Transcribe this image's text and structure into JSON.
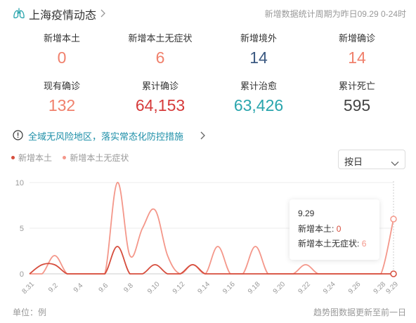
{
  "header": {
    "title": "上海疫情动态",
    "note": "新增数据统计周期为昨日09.29 0-24时",
    "icon": "lungs-icon"
  },
  "stats": [
    {
      "label": "新增本土",
      "value": "0",
      "color": "#f0806c"
    },
    {
      "label": "新增本土无症状",
      "value": "6",
      "color": "#f0806c"
    },
    {
      "label": "新增境外",
      "value": "14",
      "color": "#3c5a82"
    },
    {
      "label": "新增确诊",
      "value": "14",
      "color": "#f0806c"
    },
    {
      "label": "现有确诊",
      "value": "132",
      "color": "#f0806c"
    },
    {
      "label": "累计确诊",
      "value": "64,153",
      "color": "#d63a3a"
    },
    {
      "label": "累计治愈",
      "value": "63,426",
      "color": "#2aa5ad"
    },
    {
      "label": "累计死亡",
      "value": "595",
      "color": "#444444"
    }
  ],
  "notice": {
    "text": "全域无风险地区，落实常态化防控措施"
  },
  "legend": [
    {
      "label": "新增本土",
      "color": "#d64d3d"
    },
    {
      "label": "新增本土无症状",
      "color": "#f4978a"
    }
  ],
  "select": {
    "value": "按日"
  },
  "tooltip": {
    "date": "9.29",
    "row1_label": "新增本土:",
    "row1_value": "0",
    "row2_label": "新增本土无症状:",
    "row2_value": "6"
  },
  "footer": {
    "left": "单位：例",
    "right": "趋势图数据更新至前一日"
  },
  "chart_data": {
    "type": "line",
    "x": [
      "8.31",
      "9.1",
      "9.2",
      "9.3",
      "9.4",
      "9.5",
      "9.6",
      "9.7",
      "9.8",
      "9.9",
      "9.10",
      "9.11",
      "9.12",
      "9.13",
      "9.14",
      "9.15",
      "9.16",
      "9.17",
      "9.18",
      "9.19",
      "9.20",
      "9.21",
      "9.22",
      "9.23",
      "9.24",
      "9.25",
      "9.26",
      "9.27",
      "9.28",
      "9.29"
    ],
    "x_tick_labels": [
      "8.31",
      "9.2",
      "9.4",
      "9.6",
      "9.8",
      "9.10",
      "9.12",
      "9.14",
      "9.16",
      "9.18",
      "9.20",
      "9.22",
      "9.24",
      "9.26",
      "9.28",
      "9.29"
    ],
    "y_ticks": [
      0,
      5,
      10
    ],
    "ylim": [
      0,
      11
    ],
    "series": [
      {
        "name": "新增本土",
        "color": "#d64d3d",
        "values": [
          0,
          1,
          1,
          0,
          0,
          0,
          0,
          3,
          0,
          0,
          1,
          0,
          0,
          1,
          0,
          0,
          0,
          0,
          0,
          0,
          0,
          0,
          0,
          0,
          0,
          0,
          0,
          0,
          0,
          0
        ]
      },
      {
        "name": "新增本土无症状",
        "color": "#f4978a",
        "values": [
          0,
          0,
          2,
          0,
          0,
          0,
          0,
          10,
          2,
          5,
          7,
          2,
          0,
          1,
          0,
          3,
          0,
          0,
          3,
          0,
          0,
          0,
          1,
          0,
          0,
          0,
          0,
          0,
          0,
          6
        ]
      }
    ],
    "grid": true,
    "legend_position": "top-left"
  }
}
